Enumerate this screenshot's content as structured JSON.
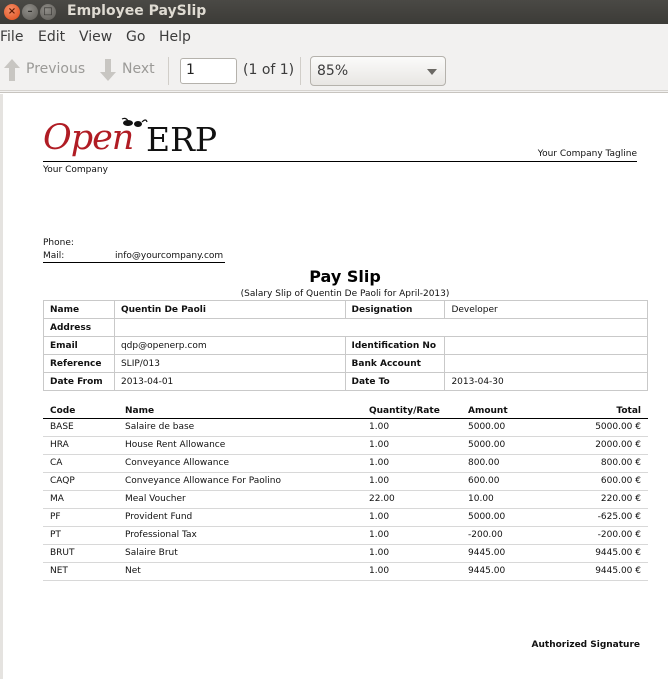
{
  "window": {
    "title": "Employee PaySlip"
  },
  "menu": [
    "File",
    "Edit",
    "View",
    "Go",
    "Help"
  ],
  "toolbar": {
    "previous_label": "Previous",
    "next_label": "Next",
    "page_value": "1",
    "page_count": "(1 of 1)",
    "zoom": "85%"
  },
  "report": {
    "logo_open": "Open",
    "logo_erp": "ERP",
    "tagline": "Your Company Tagline",
    "company": "Your Company",
    "phone_label": "Phone:",
    "mail_label": "Mail:",
    "mail_value": "info@yourcompany.com",
    "title": "Pay Slip",
    "subtitle": "(Salary Slip of Quentin De Paoli for April-2013)",
    "info": {
      "name_label": "Name",
      "name_value": "Quentin De Paoli",
      "designation_label": "Designation",
      "designation_value": "Developer",
      "address_label": "Address",
      "email_label": "Email",
      "email_value": "qdp@openerp.com",
      "idno_label": "Identification No",
      "reference_label": "Reference",
      "reference_value": "SLIP/013",
      "bank_label": "Bank Account",
      "datefrom_label": "Date From",
      "datefrom_value": "2013-04-01",
      "dateto_label": "Date To",
      "dateto_value": "2013-04-30"
    },
    "columns": {
      "code": "Code",
      "name": "Name",
      "qty": "Quantity/Rate",
      "amount": "Amount",
      "total": "Total"
    },
    "lines": [
      {
        "code": "BASE",
        "name": "Salaire de base",
        "qty": "1.00",
        "amount": "5000.00",
        "total": "5000.00 €"
      },
      {
        "code": "HRA",
        "name": "House Rent Allowance",
        "qty": "1.00",
        "amount": "5000.00",
        "total": "2000.00 €"
      },
      {
        "code": "CA",
        "name": "Conveyance Allowance",
        "qty": "1.00",
        "amount": "800.00",
        "total": "800.00 €"
      },
      {
        "code": "CAQP",
        "name": "Conveyance Allowance For Paolino",
        "qty": "1.00",
        "amount": "600.00",
        "total": "600.00 €"
      },
      {
        "code": "MA",
        "name": "Meal Voucher",
        "qty": "22.00",
        "amount": "10.00",
        "total": "220.00 €"
      },
      {
        "code": "PF",
        "name": "Provident Fund",
        "qty": "1.00",
        "amount": "5000.00",
        "total": "-625.00 €"
      },
      {
        "code": "PT",
        "name": "Professional Tax",
        "qty": "1.00",
        "amount": "-200.00",
        "total": "-200.00 €"
      },
      {
        "code": "BRUT",
        "name": "Salaire Brut",
        "qty": "1.00",
        "amount": "9445.00",
        "total": "9445.00 €"
      },
      {
        "code": "NET",
        "name": "Net",
        "qty": "1.00",
        "amount": "9445.00",
        "total": "9445.00 €"
      }
    ],
    "signature": "Authorized Signature"
  },
  "colors": {
    "logo_red": "#b01c24",
    "titlebar": "#3c3b37",
    "close_button": "#df4a16"
  }
}
